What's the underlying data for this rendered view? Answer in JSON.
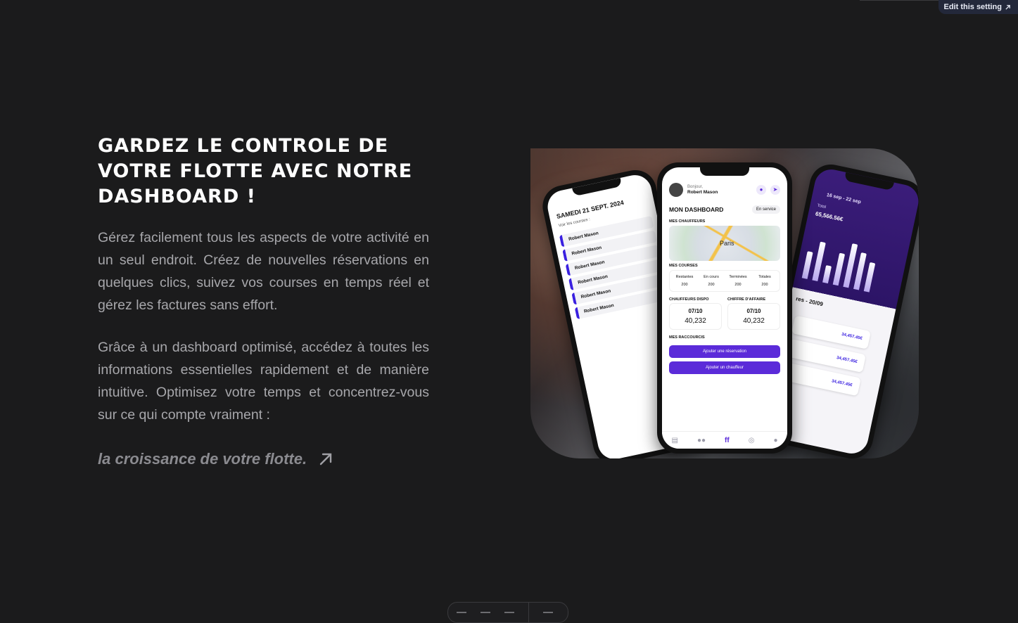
{
  "toolbar": {
    "edit_setting_label": "Edit this setting",
    "edit_setting_icon": "arrow-up-right-icon"
  },
  "hero": {
    "headline": "Gardez le controle de votre flotte avec notre dashboard !",
    "paragraph_1": "Gérez facilement tous les aspects de votre activité en un seul endroit. Créez de nouvelles réservations en quelques clics, suivez vos courses en temps réel et gérez les factures sans effort.",
    "paragraph_2": "Grâce à un dashboard optimisé, accédez à toutes les informations essentielles rapidement et de manière intuitive. Optimisez votre temps et concentrez-vous sur ce qui compte vraiment :",
    "cta_label": "la croissance de votre flotte.",
    "cta_icon": "arrow-up-right-icon"
  },
  "phone_left": {
    "date": "SAMEDI 21 SEPT. 2024",
    "filter_label": "Voir les courses :",
    "rows": [
      "Robert Mason",
      "Robert Mason",
      "Robert Mason",
      "Robert Mason",
      "Robert Mason",
      "Robert Mason"
    ]
  },
  "phone_center": {
    "greeting": "Bonjour,",
    "user": "Robert Mason",
    "title": "MON DASHBOARD",
    "status": "En service",
    "drivers_label": "Mes chauffeurs",
    "map_city": "Paris",
    "rides_label": "Mes courses",
    "ride_stats": [
      {
        "label": "Restantes",
        "value": "200"
      },
      {
        "label": "En cours",
        "value": "200"
      },
      {
        "label": "Terminées",
        "value": "200"
      },
      {
        "label": "Totales",
        "value": "200"
      }
    ],
    "available_drivers_label": "Chauffeurs dispo",
    "available_drivers_ratio": "07/10",
    "available_drivers_value": "40,232",
    "turnover_label": "Chiffre d'affaire",
    "turnover_ratio": "07/10",
    "turnover_value": "40,232",
    "shortcuts_label": "Mes raccourcis",
    "button_add_booking": "Ajouter une réservation",
    "button_add_driver": "Ajouter un chauffeur"
  },
  "phone_right": {
    "range": "16 sep - 22 sep",
    "total_label": "Total",
    "total_value": "65,566.56€",
    "bar_levels": [
      0.55,
      0.8,
      0.35,
      0.65,
      0.9,
      0.75,
      0.6
    ],
    "week_label": "res - 20/09",
    "items": [
      "34,457.45€",
      "34,457.45€",
      "34,457.45€"
    ]
  }
}
